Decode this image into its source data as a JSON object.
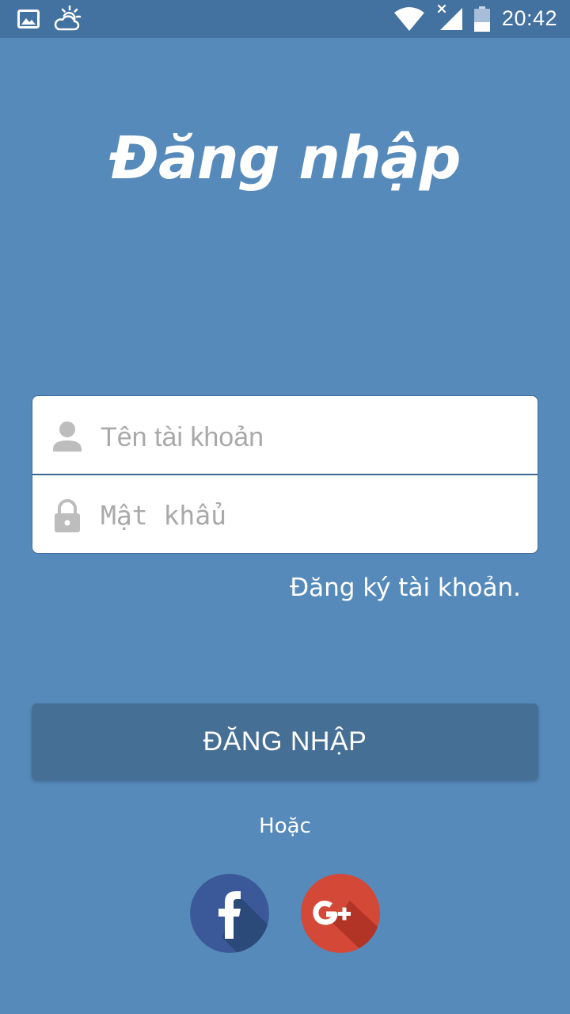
{
  "status_bar": {
    "time": "20:42",
    "left_icons": [
      "image-icon",
      "weather-icon"
    ],
    "right_icons": [
      "wifi-icon",
      "signal-icon",
      "battery-icon"
    ]
  },
  "title": "Đăng nhập",
  "form": {
    "username": {
      "placeholder": "Tên tài khoản",
      "value": "",
      "icon": "user-icon"
    },
    "password": {
      "placeholder": "Mật khẩu",
      "value": "",
      "icon": "lock-icon"
    }
  },
  "register_link": "Đăng ký tài khoản.",
  "login_button": "ĐĂNG NHẬP",
  "or_text": "Hoặc",
  "social": {
    "facebook_icon": "facebook-icon",
    "google_icon": "google-plus-icon"
  },
  "colors": {
    "background": "#568abb",
    "status_bar": "#4371a0",
    "button": "#466f96",
    "facebook": "#3b5998",
    "google": "#d34836"
  }
}
